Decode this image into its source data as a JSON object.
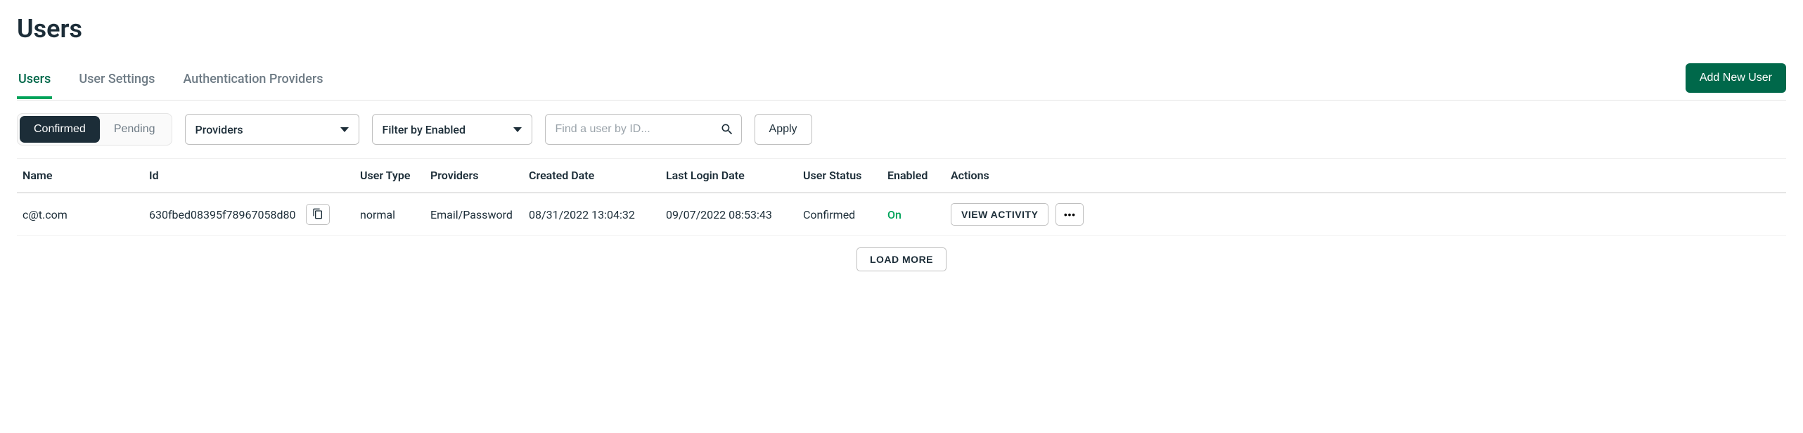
{
  "page_title": "Users",
  "tabs": [
    {
      "label": "Users",
      "active": true
    },
    {
      "label": "User Settings",
      "active": false
    },
    {
      "label": "Authentication Providers",
      "active": false
    }
  ],
  "add_user_label": "Add New User",
  "filters": {
    "segments": [
      {
        "label": "Confirmed",
        "active": true
      },
      {
        "label": "Pending",
        "active": false
      }
    ],
    "providers_select_label": "Providers",
    "enabled_select_label": "Filter by Enabled",
    "search_placeholder": "Find a user by ID...",
    "apply_label": "Apply"
  },
  "columns": {
    "name": "Name",
    "id": "Id",
    "user_type": "User Type",
    "providers": "Providers",
    "created_date": "Created Date",
    "last_login_date": "Last Login Date",
    "user_status": "User Status",
    "enabled": "Enabled",
    "actions": "Actions"
  },
  "rows": [
    {
      "name": "c@t.com",
      "id": "630fbed08395f78967058d80",
      "user_type": "normal",
      "providers": "Email/Password",
      "created_date": "08/31/2022 13:04:32",
      "last_login_date": "09/07/2022 08:53:43",
      "user_status": "Confirmed",
      "enabled": "On",
      "view_activity_label": "VIEW ACTIVITY",
      "more_label": "•••"
    }
  ],
  "load_more_label": "LOAD MORE"
}
